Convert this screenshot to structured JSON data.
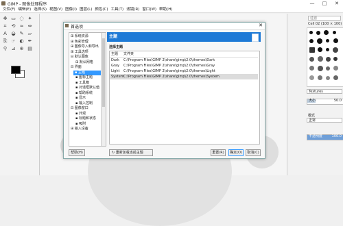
{
  "window": {
    "title": "GIMP - 图像处理程序",
    "controls": [
      "—",
      "□",
      "✕"
    ]
  },
  "menu": [
    "文件(F)",
    "编辑(E)",
    "选择(S)",
    "视图(V)",
    "图像(I)",
    "图层(L)",
    "颜色(C)",
    "工具(T)",
    "滤镜(R)",
    "窗口(W)",
    "帮助(H)"
  ],
  "brushes": {
    "filter_placeholder": "过滤",
    "current_brush": "Cell 02 (100 × 100)",
    "tag_dropdown": "Textures"
  },
  "tool_options": {
    "opacity_label": "不透明度",
    "opacity_value": "100.0",
    "mode_label": "模式",
    "mode_value": "正常",
    "size_label": "大小",
    "size_value": "50.0"
  },
  "dialog": {
    "title": "首选项",
    "tree": [
      "系统资源",
      "色彩管理",
      "图像导入和导出",
      "工具选项",
      "默认图像",
      "默认网格",
      "界面",
      "主题",
      "图标主题",
      "工具箱",
      "对话框默认值",
      "帮助系统",
      "显示",
      "输入控制",
      "图像窗口",
      "外观",
      "标题和状态",
      "吸附",
      "输入设备"
    ],
    "selected_index": 7,
    "header": "主题",
    "section_label": "选择主题",
    "columns": [
      "主题",
      "文件夹"
    ],
    "themes": [
      {
        "name": "Dark",
        "folder": "C:\\Program Files\\GIMP 2\\share\\gimp\\2.0\\themes\\Dark"
      },
      {
        "name": "Gray",
        "folder": "C:\\Program Files\\GIMP 2\\share\\gimp\\2.0\\themes\\Gray"
      },
      {
        "name": "Light",
        "folder": "C:\\Program Files\\GIMP 2\\share\\gimp\\2.0\\themes\\Light"
      },
      {
        "name": "System",
        "folder": "C:\\Program Files\\GIMP 2\\share\\gimp\\2.0\\themes\\System"
      }
    ],
    "selected_theme_index": 3,
    "reload_label": "重新加载当前主题",
    "buttons": {
      "help": "帮助(H)",
      "reset": "重置(R)",
      "ok": "确定(O)",
      "cancel": "取消(C)"
    }
  }
}
